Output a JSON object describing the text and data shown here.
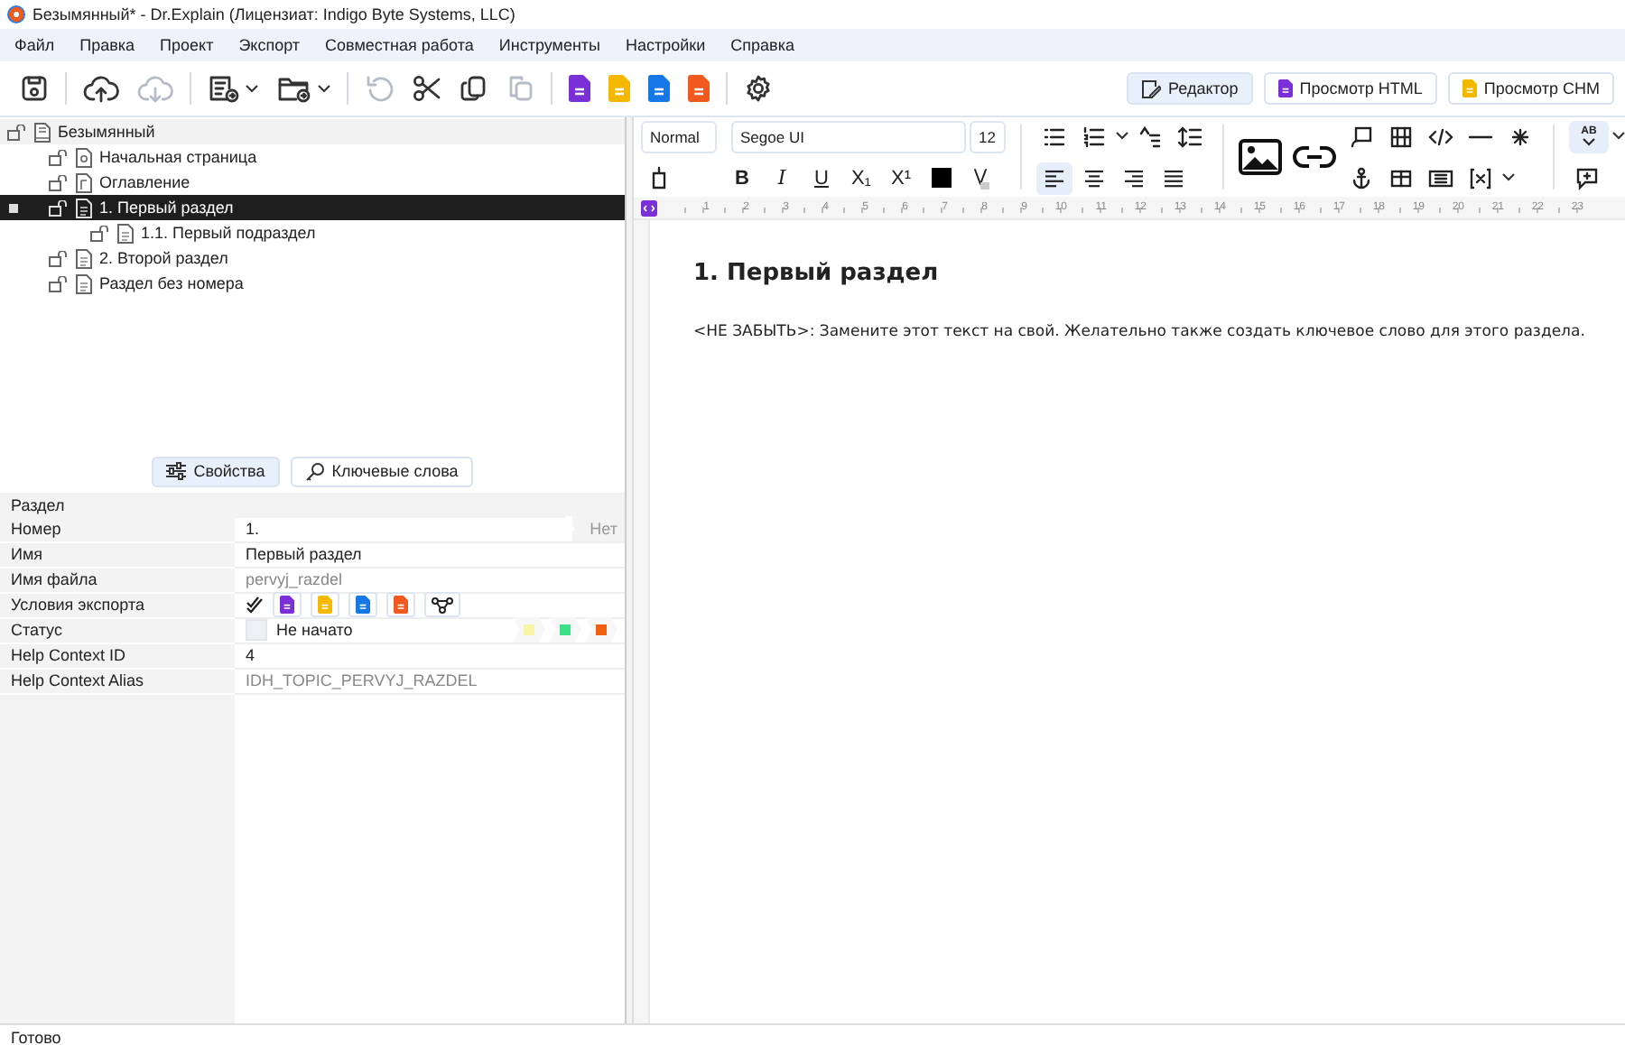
{
  "window": {
    "title": "Безымянный* - Dr.Explain (Лицензиат: Indigo Byte Systems, LLC)"
  },
  "menu": [
    "Файл",
    "Правка",
    "Проект",
    "Экспорт",
    "Совместная работа",
    "Инструменты",
    "Настройки",
    "Справка"
  ],
  "toolbar": [
    {
      "kind": "save",
      "disabled": false
    },
    {
      "kind": "separator"
    },
    {
      "kind": "upload",
      "disabled": false
    },
    {
      "kind": "download",
      "disabled": true
    },
    {
      "kind": "separator"
    },
    {
      "kind": "new-topic",
      "disabled": false,
      "dropdown": true
    },
    {
      "kind": "new-folder",
      "disabled": false,
      "dropdown": true
    },
    {
      "kind": "separator"
    },
    {
      "kind": "undo",
      "disabled": true
    },
    {
      "kind": "cut",
      "disabled": false
    },
    {
      "kind": "copy",
      "disabled": false
    },
    {
      "kind": "paste",
      "disabled": true
    },
    {
      "kind": "separator"
    },
    {
      "kind": "html",
      "disabled": false
    },
    {
      "kind": "chm",
      "disabled": false
    },
    {
      "kind": "word",
      "disabled": false
    },
    {
      "kind": "pdf",
      "disabled": false
    },
    {
      "kind": "separator"
    },
    {
      "kind": "settings",
      "disabled": false
    }
  ],
  "view_tabs": [
    {
      "kind": "editor",
      "label": "Редактор",
      "selected": true
    },
    {
      "kind": "html",
      "label": "Просмотр HTML",
      "selected": false
    },
    {
      "kind": "chm",
      "label": "Просмотр CHM",
      "selected": false
    }
  ],
  "tree": {
    "label": "Безымянный",
    "kind": "book",
    "selected": false,
    "children": [
      {
        "label": "Начальная страница",
        "kind": "home",
        "selected": false
      },
      {
        "label": "Оглавление",
        "kind": "toc",
        "selected": false
      },
      {
        "label": "1. Первый раздел",
        "kind": "page",
        "selected": true,
        "children": [
          {
            "label": "1.1. Первый подраздел",
            "kind": "page",
            "selected": false
          }
        ]
      },
      {
        "label": "2. Второй раздел",
        "kind": "page",
        "selected": false
      },
      {
        "label": "Раздел без номера",
        "kind": "page",
        "selected": false
      }
    ]
  },
  "format_bar": {
    "style": "Normal",
    "font": "Segoe UI",
    "size": "12",
    "text_styles": [
      {
        "kind": "bold",
        "label": "B"
      },
      {
        "kind": "italic",
        "label": "I"
      },
      {
        "kind": "underline",
        "label": "U"
      },
      {
        "kind": "subscript",
        "label": "X₁"
      },
      {
        "kind": "superscript",
        "label": "X¹"
      }
    ],
    "alignment": [
      {
        "kind": "left",
        "selected": true
      },
      {
        "kind": "center",
        "selected": false
      },
      {
        "kind": "right",
        "selected": false
      },
      {
        "kind": "justify",
        "selected": false
      }
    ],
    "spellcheck": {
      "label": "AB",
      "selected": true
    }
  },
  "ruler": [
    "1",
    "2",
    "3",
    "4",
    "5",
    "6",
    "7",
    "8",
    "9",
    "10",
    "11",
    "12",
    "13",
    "14",
    "15",
    "16",
    "17",
    "18",
    "19",
    "20",
    "21",
    "22",
    "23"
  ],
  "document": {
    "heading": "1. Первый раздел",
    "paragraph": "<НЕ ЗАБЫТЬ>: Замените этот текст на свой. Желательно также создать ключевое слово для этого раздела."
  },
  "panel_tabs": [
    {
      "kind": "properties",
      "label": "Свойства",
      "selected": true
    },
    {
      "kind": "keywords",
      "label": "Ключевые слова",
      "selected": false
    }
  ],
  "properties": {
    "section": "Раздел",
    "rows": [
      {
        "kind": "text",
        "label": "Номер",
        "value": "1.",
        "tag": "Нет"
      },
      {
        "kind": "text",
        "label": "Имя",
        "value": "Первый раздел"
      },
      {
        "kind": "muted",
        "label": "Имя файла",
        "value": "pervyj_razdel"
      },
      {
        "kind": "export",
        "label": "Условия экспорта",
        "items": [
          {
            "kind": "check"
          },
          {
            "kind": "html"
          },
          {
            "kind": "chm"
          },
          {
            "kind": "word"
          },
          {
            "kind": "pdf"
          },
          {
            "kind": "graph"
          }
        ]
      },
      {
        "kind": "status",
        "label": "Статус",
        "value": "Не начато",
        "checked": false,
        "steps": [
          {
            "color": "#f8f5a6"
          },
          {
            "color": "#3ee08a"
          },
          {
            "color": "#f06010"
          }
        ]
      },
      {
        "kind": "text",
        "label": "Help Context ID",
        "value": "4"
      },
      {
        "kind": "muted",
        "label": "Help Context Alias",
        "value": "IDH_TOPIC_PERVYJ_RAZDEL"
      }
    ]
  },
  "status_bar": "Готово"
}
